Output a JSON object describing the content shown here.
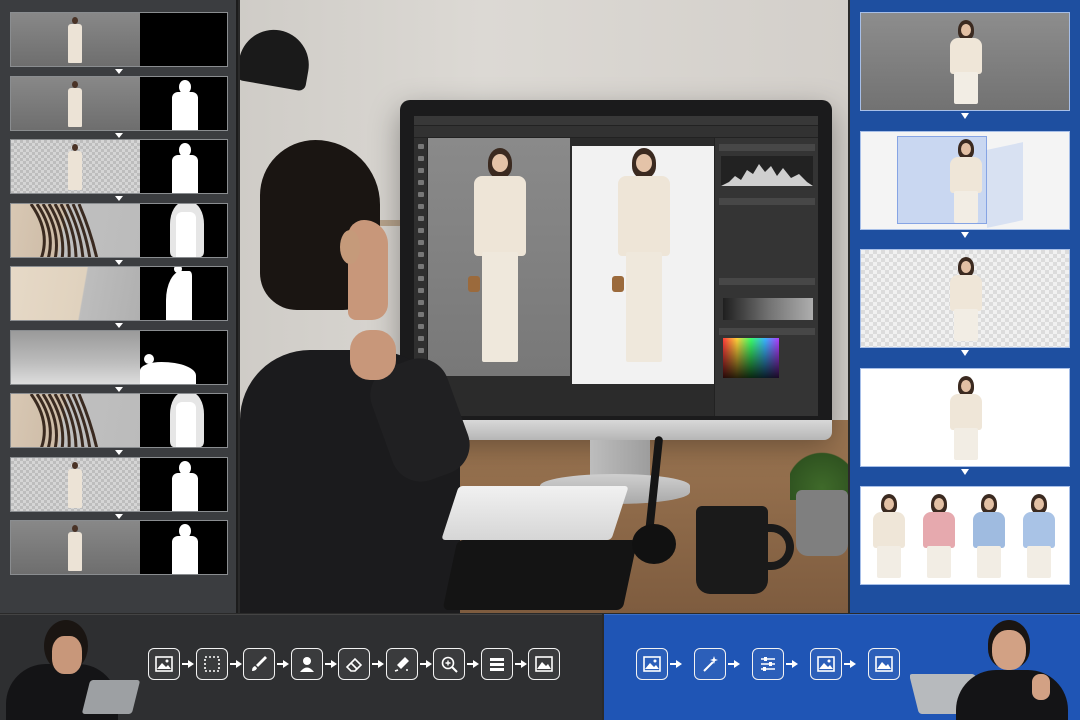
{
  "manual_steps": [
    {
      "name": "original-photo",
      "style": "gray",
      "mask": "none"
    },
    {
      "name": "rough-selection",
      "style": "gray",
      "mask": "rough"
    },
    {
      "name": "transparent-cutout",
      "style": "checker",
      "mask": "full"
    },
    {
      "name": "hair-refine",
      "style": "hair",
      "mask": "hair"
    },
    {
      "name": "edge-refine",
      "style": "fabric",
      "mask": "edge"
    },
    {
      "name": "shadow-refine",
      "style": "floor",
      "mask": "shadow"
    },
    {
      "name": "hair-detail",
      "style": "hair",
      "mask": "hair"
    },
    {
      "name": "final-cutout",
      "style": "checker",
      "mask": "full"
    },
    {
      "name": "final-result",
      "style": "gray",
      "mask": "full"
    }
  ],
  "auto_steps": [
    {
      "name": "original-photo",
      "style": "gray"
    },
    {
      "name": "3d-detection",
      "style": "3d"
    },
    {
      "name": "transparent-cutout",
      "style": "checker"
    },
    {
      "name": "white-background",
      "style": "white"
    },
    {
      "name": "color-variants",
      "style": "white"
    }
  ],
  "color_variants": [
    "#efe6d8",
    "#e6a9ae",
    "#9fbbe0",
    "#a9c3e6"
  ],
  "manual_flow_icons": [
    "image-icon",
    "marquee-select-icon",
    "brush-icon",
    "person-silhouette-icon",
    "eraser-icon",
    "refine-edge-icon",
    "zoom-icon",
    "layers-icon",
    "image-result-icon"
  ],
  "auto_flow_icons": [
    "image-icon",
    "magic-wand-icon",
    "sliders-icon",
    "image-icon",
    "image-result-icon"
  ],
  "colors": {
    "manual_bg": "#2e2f31",
    "auto_bg": "#1f55b5",
    "auto_column": "#1e4fa0"
  }
}
